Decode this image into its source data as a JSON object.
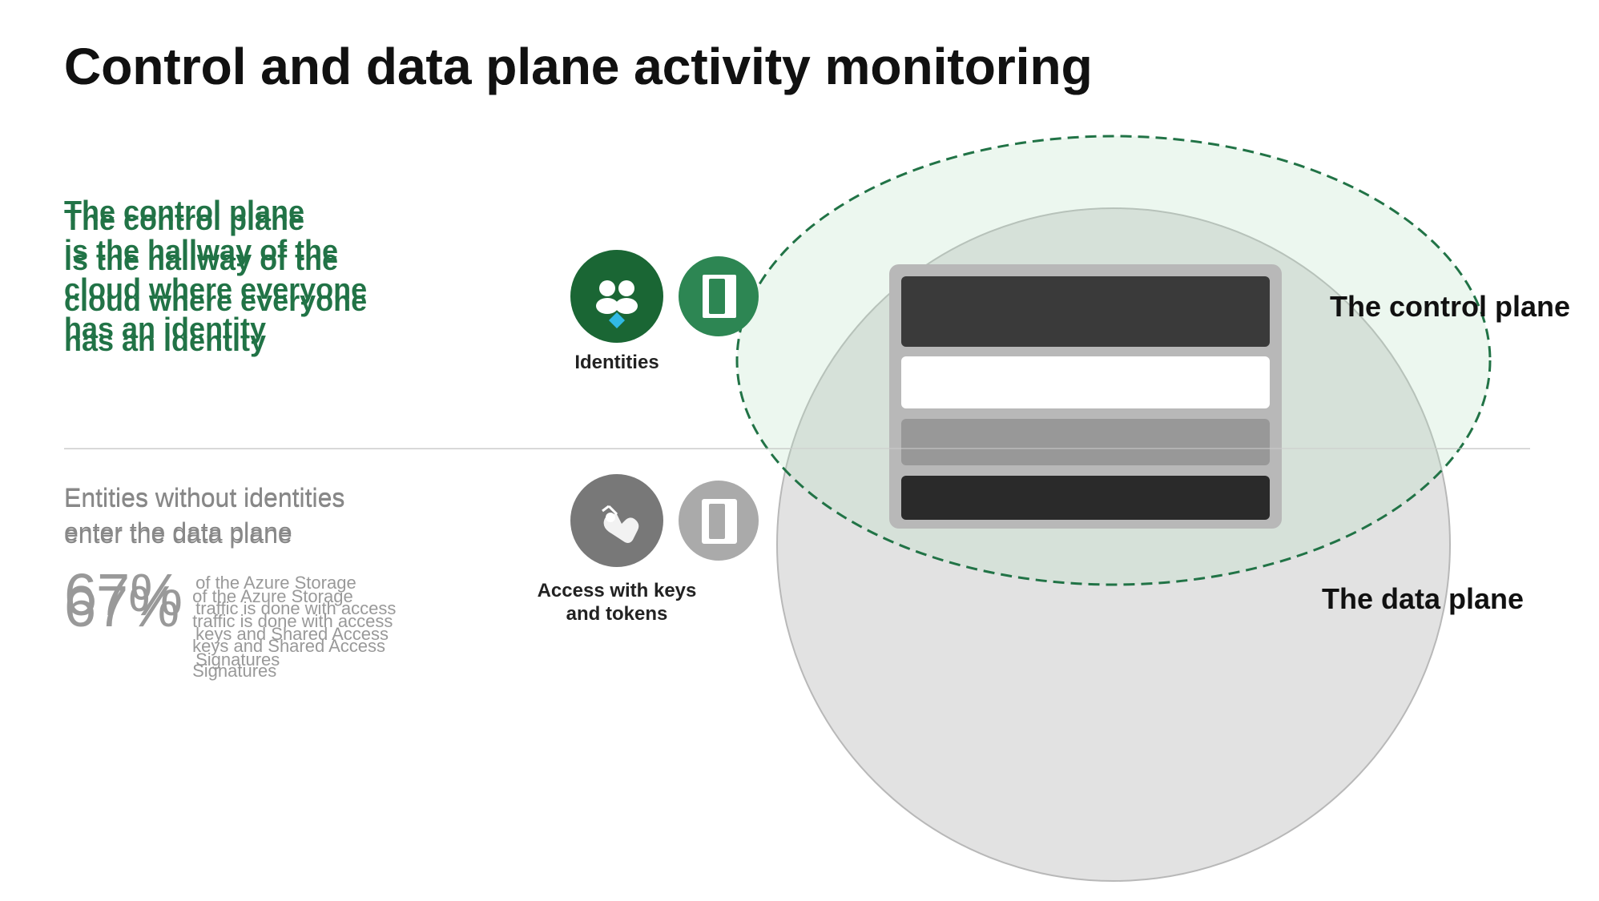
{
  "page": {
    "title": "Control and data plane activity monitoring",
    "background": "#ffffff"
  },
  "left": {
    "green_headline_line1": "The control plane",
    "green_headline_line2": "is the hallway of the",
    "green_headline_line3": "cloud where everyone",
    "green_headline_line4": "has an identity",
    "entities_line1": "Entities without identities",
    "entities_line2": "enter the data plane",
    "stat_percent": "67%",
    "stat_desc": "of the Azure Storage traffic is done with access keys and Shared Access Signatures"
  },
  "diagram": {
    "control_plane_label": "The control plane",
    "data_plane_label": "The data plane",
    "identities_label": "Identities",
    "access_label_line1": "Access with keys",
    "access_label_line2": "and tokens"
  }
}
